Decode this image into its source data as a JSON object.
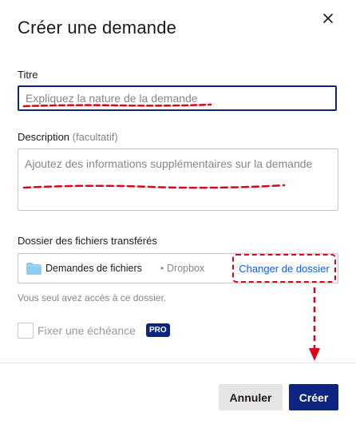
{
  "dialog": {
    "title": "Créer une demande",
    "close_icon": "close-icon"
  },
  "title_field": {
    "label": "Titre",
    "placeholder": "Expliquez la nature de la demande",
    "value": ""
  },
  "description_field": {
    "label": "Description",
    "hint": "(facultatif)",
    "placeholder": "Ajoutez des informations supplémentaires sur la demande",
    "value": ""
  },
  "folder": {
    "label": "Dossier des fichiers transférés",
    "icon": "folder-icon",
    "name": "Demandes de fichiers",
    "separator": "•",
    "location": "Dropbox",
    "change_label": "Changer de dossier",
    "access_note": "Vous seul avez accès à ce dossier."
  },
  "deadline": {
    "label": "Fixer une échéance",
    "checked": false,
    "badge": "PRO"
  },
  "footer": {
    "cancel_label": "Annuler",
    "create_label": "Créer"
  },
  "colors": {
    "primary": "#0d2481",
    "link": "#0061fe",
    "annotation": "#e0001b",
    "folder": "#8ecbf3"
  }
}
